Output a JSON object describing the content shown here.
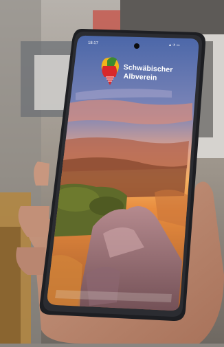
{
  "phone": {
    "status_time": "18:17",
    "status_right": "▲ ✈ ▭"
  },
  "app": {
    "logo_line1": "Schwäbischer",
    "logo_line2": "Albverein"
  },
  "colors": {
    "brand_red": "#d8282b",
    "brand_green": "#3d8a2e",
    "brand_yellow": "#f2b51a",
    "sky_top": "#4d6fb0",
    "sunset": "#f2a04a"
  }
}
